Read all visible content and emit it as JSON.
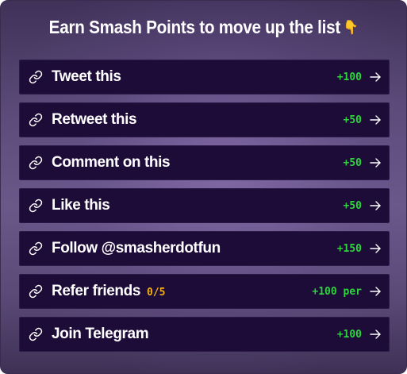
{
  "header": {
    "title": "Earn Smash Points to move up the list",
    "emoji": "👇",
    "emoji_name": "point-down-emoji"
  },
  "tasks": [
    {
      "label": "Tweet this",
      "progress": "",
      "points": "+100",
      "icon": "link-icon"
    },
    {
      "label": "Retweet this",
      "progress": "",
      "points": "+50",
      "icon": "link-icon"
    },
    {
      "label": "Comment on this",
      "progress": "",
      "points": "+50",
      "icon": "link-icon"
    },
    {
      "label": "Like this",
      "progress": "",
      "points": "+50",
      "icon": "link-icon"
    },
    {
      "label": "Follow @smasherdotfun",
      "progress": "",
      "points": "+150",
      "icon": "link-icon"
    },
    {
      "label": "Refer friends",
      "progress": "0/5",
      "points": "+100 per",
      "icon": "link-icon"
    },
    {
      "label": "Join Telegram",
      "progress": "",
      "points": "+100",
      "icon": "link-icon"
    }
  ],
  "colors": {
    "row_background": "#1d0b38",
    "points_green": "#2fd33f",
    "progress_yellow": "#f3b11a",
    "text_white": "#ffffff"
  }
}
